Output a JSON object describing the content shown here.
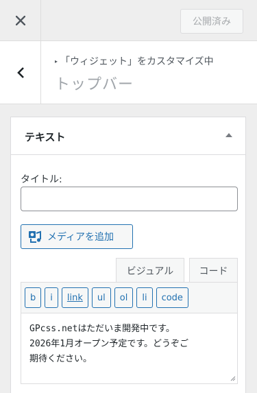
{
  "header": {
    "publish_label": "公開済み"
  },
  "section": {
    "breadcrumb": "「ウィジェット」をカスタマイズ中",
    "title": "トップバー"
  },
  "widget": {
    "name": "テキスト",
    "title_label": "タイトル:",
    "title_value": "",
    "add_media_label": "メディアを追加",
    "tabs": [
      {
        "label": "ビジュアル"
      },
      {
        "label": "コード"
      }
    ],
    "quicktags": [
      {
        "label": "b"
      },
      {
        "label": "i"
      },
      {
        "label": "link"
      },
      {
        "label": "ul"
      },
      {
        "label": "ol"
      },
      {
        "label": "li"
      },
      {
        "label": "code"
      }
    ],
    "content": "GPcss.netはただいま開発中です。\n2026年1月オープン予定です。どうぞご\n期待ください。"
  }
}
